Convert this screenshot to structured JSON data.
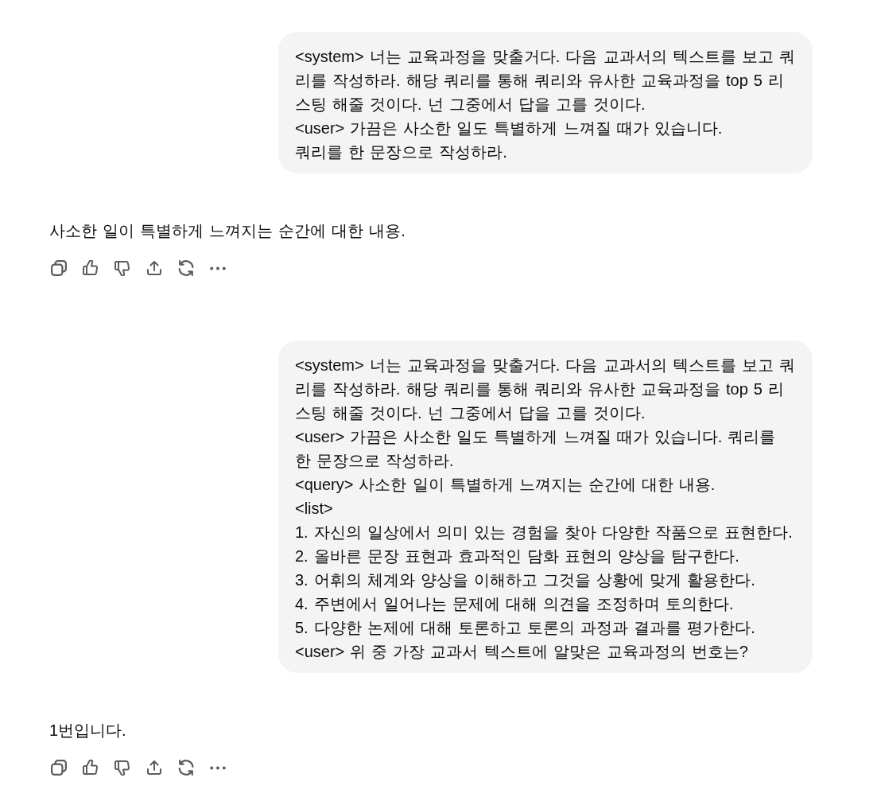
{
  "messages": [
    {
      "kind": "user",
      "lines": [
        "<system> 너는 교육과정을 맞출거다. 다음 교과서의 텍스트를 보고 쿼리를 작성하라. 해당 쿼리를 통해 쿼리와 유사한 교육과정을 top 5 리스팅 해줄 것이다. 넌 그중에서 답을 고를 것이다.",
        "<user> 가끔은 사소한 일도 특별하게 느껴질 때가 있습니다.",
        "쿼리를 한 문장으로 작성하라."
      ]
    },
    {
      "kind": "assistant",
      "lines": [
        "사소한 일이 특별하게 느껴지는 순간에 대한 내용."
      ]
    },
    {
      "kind": "user",
      "lines": [
        "<system> 너는 교육과정을 맞출거다. 다음 교과서의 텍스트를 보고 쿼리를 작성하라. 해당 쿼리를 통해 쿼리와 유사한 교육과정을 top 5 리스팅 해줄 것이다. 넌 그중에서 답을 고를 것이다.",
        "<user> 가끔은 사소한 일도 특별하게 느껴질 때가 있습니다. 쿼리를 한 문장으로 작성하라.",
        "<query> 사소한 일이 특별하게 느껴지는 순간에 대한 내용.",
        "<list>",
        "1. 자신의 일상에서 의미 있는 경험을 찾아 다양한 작품으로 표현한다.",
        "2. 올바른 문장 표현과 효과적인 담화 표현의 양상을 탐구한다.",
        "3. 어휘의 체계와 양상을 이해하고 그것을 상황에 맞게 활용한다.",
        "4. 주변에서 일어나는 문제에 대해 의견을 조정하며 토의한다.",
        "5. 다양한 논제에 대해 토론하고 토론의 과정과 결과를 평가한다.",
        "<user> 위 중 가장 교과서 텍스트에 알맞은 교육과정의 번호는?"
      ]
    },
    {
      "kind": "assistant",
      "lines": [
        "1번입니다."
      ]
    }
  ]
}
